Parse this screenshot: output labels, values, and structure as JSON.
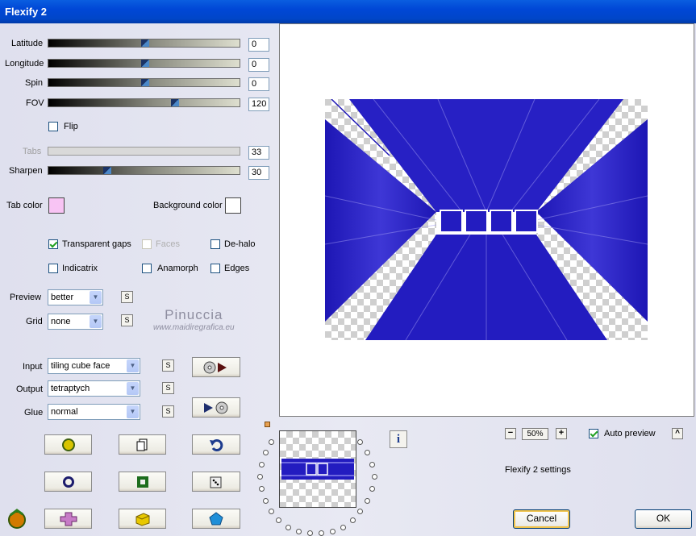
{
  "window": {
    "title": "Flexify 2"
  },
  "sliders": [
    {
      "label": "Latitude",
      "value": "0",
      "level": 0.5,
      "disabled": false
    },
    {
      "label": "Longitude",
      "value": "0",
      "level": 0.5,
      "disabled": false
    },
    {
      "label": "Spin",
      "value": "0",
      "level": 0.5,
      "disabled": false
    },
    {
      "label": "FOV",
      "value": "120",
      "level": 0.67,
      "disabled": false
    },
    {
      "label": "Tabs",
      "value": "33",
      "level": 0.33,
      "disabled": true
    },
    {
      "label": "Sharpen",
      "value": "30",
      "level": 0.3,
      "disabled": false
    }
  ],
  "flip": {
    "label": "Flip",
    "checked": false
  },
  "tab_color": {
    "label": "Tab color",
    "color": "#f8c4f4"
  },
  "background_color": {
    "label": "Background color",
    "color": "#ffffff"
  },
  "options": {
    "transparent_gaps": {
      "label": "Transparent gaps",
      "checked": true
    },
    "faces": {
      "label": "Faces",
      "checked": false,
      "disabled": true
    },
    "de_halo": {
      "label": "De-halo",
      "checked": false
    },
    "indicatrix": {
      "label": "Indicatrix",
      "checked": false
    },
    "anamorph": {
      "label": "Anamorph",
      "checked": false
    },
    "edges": {
      "label": "Edges",
      "checked": false
    }
  },
  "preview_select": {
    "label": "Preview",
    "value": "better"
  },
  "grid_select": {
    "label": "Grid",
    "value": "none"
  },
  "input_select": {
    "label": "Input",
    "value": "tiling cube face"
  },
  "output_select": {
    "label": "Output",
    "value": "tetraptych"
  },
  "glue_select": {
    "label": "Glue",
    "value": "normal"
  },
  "small_button_label": "S",
  "watermark": {
    "line1": "Pinuccia",
    "line2": "www.maidiregrafica.eu"
  },
  "zoom": {
    "minus": "−",
    "value": "50%",
    "plus": "+"
  },
  "auto_preview": {
    "label": "Auto preview",
    "checked": true
  },
  "collapse_button": "^",
  "settings_label": "Flexify 2 settings",
  "info_button": "i",
  "buttons": {
    "cancel": "Cancel",
    "ok": "OK"
  },
  "colors": {
    "preview_blue": "#1a14b8",
    "accent": "#0046c8"
  }
}
